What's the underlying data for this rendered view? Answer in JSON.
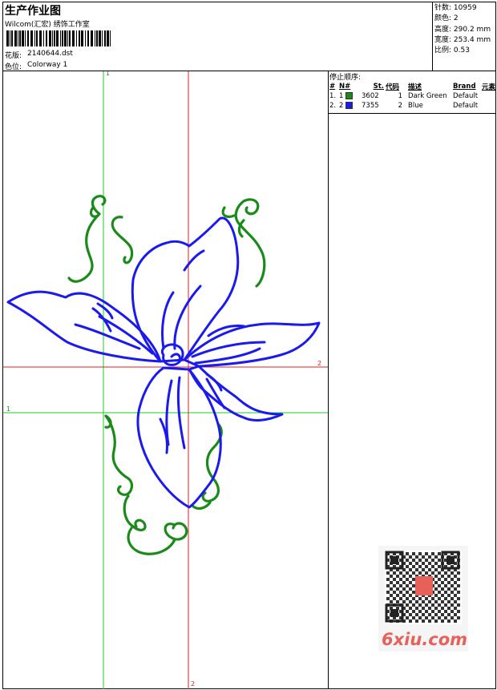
{
  "header": {
    "title": "生产作业图",
    "subtitle": "Wilcom(汇宏) 绣饰工作室",
    "design_label": "花版:",
    "design_value": "2140644.dst",
    "colorway_label": "色位:",
    "colorway_value": "Colorway 1"
  },
  "stats": [
    {
      "label": "针数:",
      "value": "10959"
    },
    {
      "label": "颜色:",
      "value": "2"
    },
    {
      "label": "高度:",
      "value": "290.2 mm"
    },
    {
      "label": "宽度:",
      "value": "253.4 mm"
    },
    {
      "label": "比例:",
      "value": "0.53"
    }
  ],
  "stop_sequence": {
    "title": "停止顺序:",
    "columns": [
      "#",
      "N#",
      "St.",
      "代码",
      "描述",
      "Brand",
      "元素"
    ],
    "rows": [
      {
        "num": "1.",
        "needle": "1",
        "code": "3602",
        "st": "1",
        "desc": "Dark Green",
        "brand": "Default",
        "color": "#1a8a1a"
      },
      {
        "num": "2.",
        "needle": "2",
        "code": "7355",
        "st": "2",
        "desc": "Blue",
        "brand": "Default",
        "color": "#1a1aee"
      }
    ]
  },
  "guides": {
    "v1": "1",
    "h1": "1",
    "v2": "2",
    "h2": "2"
  },
  "colors": {
    "green_guide": "#22cc22",
    "red_guide": "#dd2222",
    "thread_green": "#1a8a1a",
    "thread_blue": "#1a1aee"
  },
  "watermark_text": "6xiu.com"
}
